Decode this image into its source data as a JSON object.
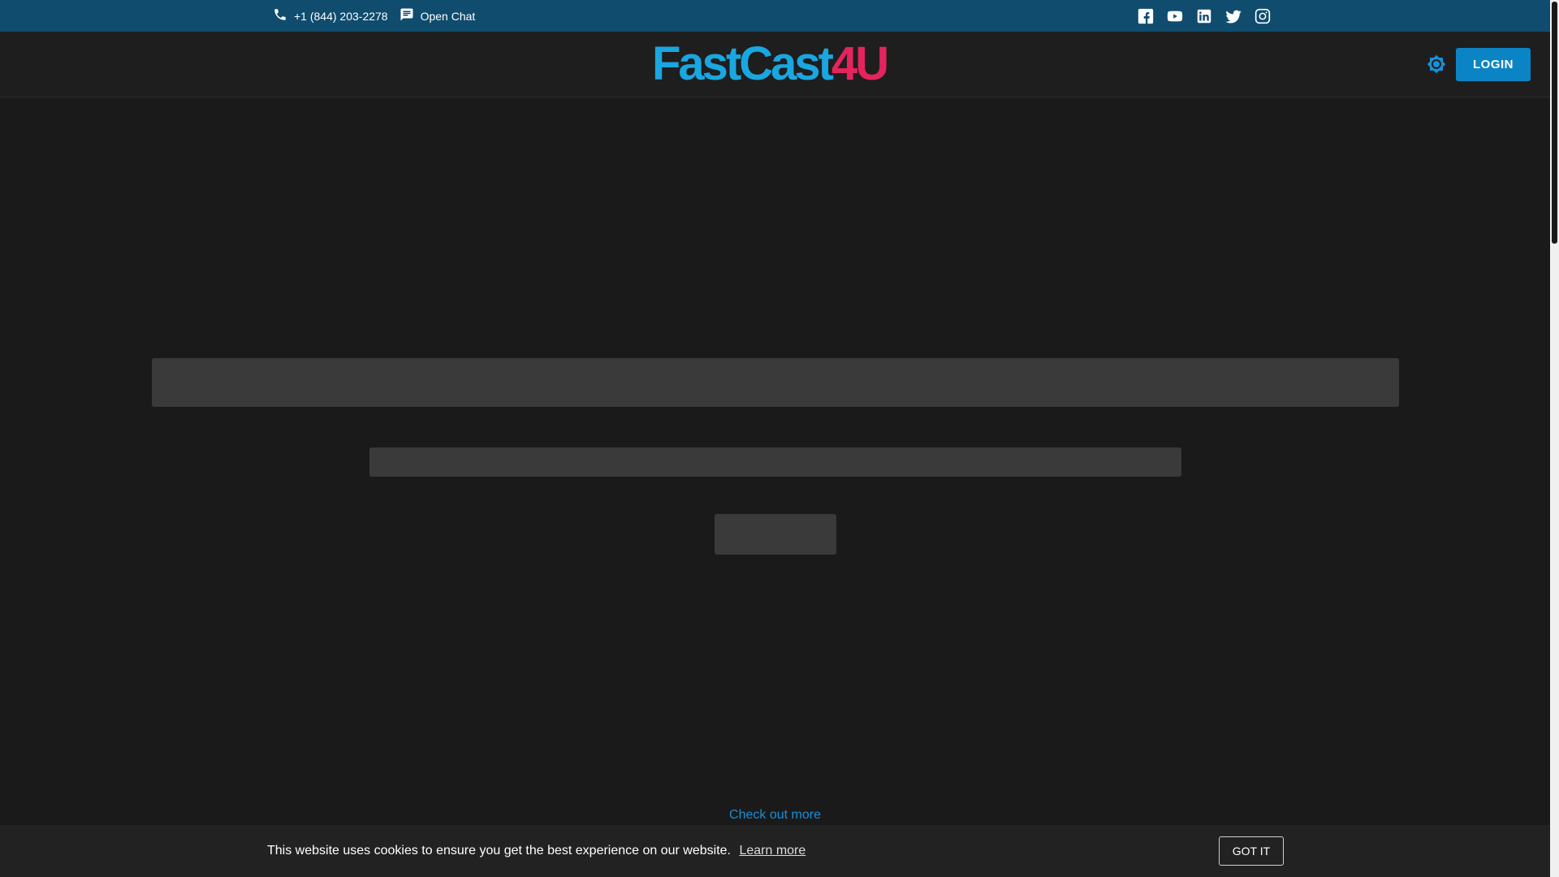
{
  "topbar": {
    "phone": "+1 (844) 203-2278",
    "chat_label": "Open Chat",
    "socials": [
      "facebook-icon",
      "youtube-icon",
      "linkedin-icon",
      "twitter-icon",
      "instagram-icon"
    ]
  },
  "header": {
    "logo_part1": "FastCast",
    "logo_part2": "4U",
    "login_label": "LOGIN"
  },
  "main": {
    "check_out_more": "Check out more"
  },
  "cookie": {
    "message": "This website uses cookies to ensure you get the best experience on our website.",
    "learn_more": "Learn more",
    "accept_label": "GOT IT"
  },
  "colors": {
    "brand_blue": "#1aa6e0",
    "brand_pink": "#e5245e",
    "topbar": "#0f4c6e",
    "accent": "#0b84c6"
  }
}
